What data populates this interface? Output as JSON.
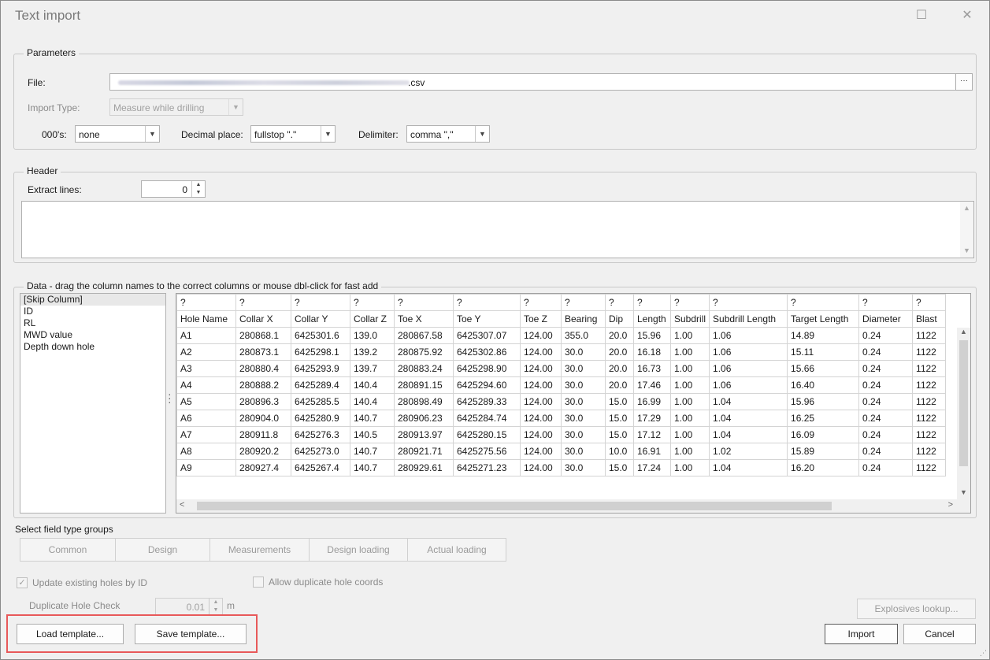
{
  "window": {
    "title": "Text import",
    "maximize_icon": "maximize-icon",
    "close_icon": "close-icon"
  },
  "parameters": {
    "group_title": "Parameters",
    "file_label": "File:",
    "file_value_suffix": ".csv",
    "browse_label": "···",
    "import_type_label": "Import Type:",
    "import_type_value": "Measure while drilling",
    "thousands_label": "000's:",
    "thousands_value": "none",
    "decimal_label": "Decimal place:",
    "decimal_value": "fullstop \".\"",
    "delimiter_label": "Delimiter:",
    "delimiter_value": "comma \",\""
  },
  "header": {
    "group_title": "Header",
    "extract_label": "Extract lines:",
    "extract_value": "0"
  },
  "data": {
    "group_title": "Data - drag the column names to the correct columns or mouse dbl-click for fast add",
    "column_names": [
      "[Skip Column]",
      "ID",
      "RL",
      "MWD value",
      "Depth down hole"
    ],
    "mapping_row": [
      "?",
      "?",
      "?",
      "?",
      "?",
      "?",
      "?",
      "?",
      "?",
      "?",
      "?",
      "?",
      "?",
      "?",
      "?"
    ],
    "headers": [
      "Hole Name",
      "Collar X",
      "Collar Y",
      "Collar Z",
      "Toe X",
      "Toe Y",
      "Toe Z",
      "Bearing",
      "Dip",
      "Length",
      "Subdrill",
      "Subdrill Length",
      "Target Length",
      "Diameter",
      "Blast"
    ],
    "rows": [
      [
        "A1",
        "280868.1",
        "6425301.6",
        "139.0",
        "280867.58",
        "6425307.07",
        "124.00",
        "355.0",
        "20.0",
        "15.96",
        "1.00",
        "1.06",
        "14.89",
        "0.24",
        "1122"
      ],
      [
        "A2",
        "280873.1",
        "6425298.1",
        "139.2",
        "280875.92",
        "6425302.86",
        "124.00",
        "30.0",
        "20.0",
        "16.18",
        "1.00",
        "1.06",
        "15.11",
        "0.24",
        "1122"
      ],
      [
        "A3",
        "280880.4",
        "6425293.9",
        "139.7",
        "280883.24",
        "6425298.90",
        "124.00",
        "30.0",
        "20.0",
        "16.73",
        "1.00",
        "1.06",
        "15.66",
        "0.24",
        "1122"
      ],
      [
        "A4",
        "280888.2",
        "6425289.4",
        "140.4",
        "280891.15",
        "6425294.60",
        "124.00",
        "30.0",
        "20.0",
        "17.46",
        "1.00",
        "1.06",
        "16.40",
        "0.24",
        "1122"
      ],
      [
        "A5",
        "280896.3",
        "6425285.5",
        "140.4",
        "280898.49",
        "6425289.33",
        "124.00",
        "30.0",
        "15.0",
        "16.99",
        "1.00",
        "1.04",
        "15.96",
        "0.24",
        "1122"
      ],
      [
        "A6",
        "280904.0",
        "6425280.9",
        "140.7",
        "280906.23",
        "6425284.74",
        "124.00",
        "30.0",
        "15.0",
        "17.29",
        "1.00",
        "1.04",
        "16.25",
        "0.24",
        "1122"
      ],
      [
        "A7",
        "280911.8",
        "6425276.3",
        "140.5",
        "280913.97",
        "6425280.15",
        "124.00",
        "30.0",
        "15.0",
        "17.12",
        "1.00",
        "1.04",
        "16.09",
        "0.24",
        "1122"
      ],
      [
        "A8",
        "280920.2",
        "6425273.0",
        "140.7",
        "280921.71",
        "6425275.56",
        "124.00",
        "30.0",
        "10.0",
        "16.91",
        "1.00",
        "1.02",
        "15.89",
        "0.24",
        "1122"
      ],
      [
        "A9",
        "280927.4",
        "6425267.4",
        "140.7",
        "280929.61",
        "6425271.23",
        "124.00",
        "30.0",
        "15.0",
        "17.24",
        "1.00",
        "1.04",
        "16.20",
        "0.24",
        "1122"
      ]
    ]
  },
  "field_groups": {
    "label": "Select field type groups",
    "items": [
      "Common",
      "Design",
      "Measurements",
      "Design loading",
      "Actual loading"
    ]
  },
  "options": {
    "update_existing_label": "Update existing holes by ID",
    "update_existing_checked": true,
    "allow_duplicate_label": "Allow duplicate hole coords",
    "allow_duplicate_checked": false,
    "duplicate_check_label": "Duplicate Hole Check",
    "duplicate_check_value": "0.01",
    "duplicate_check_unit": "m"
  },
  "buttons": {
    "explosives_lookup": "Explosives lookup...",
    "load_template": "Load template...",
    "save_template": "Save template...",
    "import": "Import",
    "cancel": "Cancel"
  },
  "colors": {
    "highlight": "#e8595a",
    "dialog_bg": "#f0f0f0"
  }
}
